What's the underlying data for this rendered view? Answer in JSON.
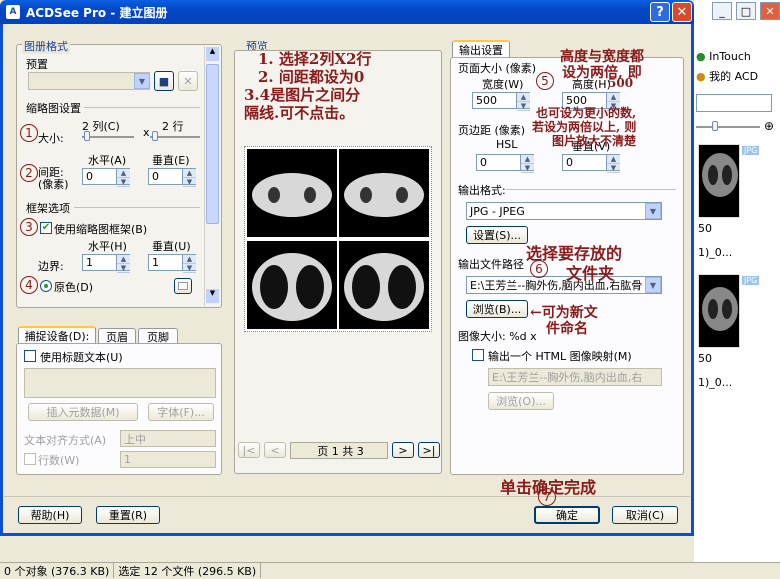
{
  "window": {
    "title": "ACDSee Pro - 建立图册",
    "help_glyph": "?",
    "close_glyph": "✕"
  },
  "left": {
    "group_title": "图册格式",
    "preset_label": "预置",
    "thumb_settings_label": "缩略图设置",
    "size_label": "大小:",
    "cols_label": "2 列(C)",
    "x_sep": "x",
    "rows_label": "2 行",
    "spacing_label": "间距:",
    "pixels_label": "(像素)",
    "horizontal_label": "水平(A)",
    "vertical_label": "垂直(E)",
    "spacing_h_value": "0",
    "spacing_v_value": "0",
    "frame_options_label": "框架选项",
    "use_frame_label": "使用缩略图框架(B)",
    "frame_h_label": "水平(H)",
    "frame_v_label": "垂直(U)",
    "border_label": "边界:",
    "border_h_value": "1",
    "border_v_value": "1",
    "original_color_label": "原色(D)"
  },
  "capture": {
    "tabs": [
      "捕捉设备(D):",
      "页眉",
      "页脚"
    ],
    "use_title_text_label": "使用标题文本(U)",
    "insert_metadata_label": "插入元数据(M)",
    "font_label": "字体(F)...",
    "text_align_label": "文本对齐方式(A)",
    "text_align_value": "上中",
    "rows_label": "行数(W)",
    "rows_value": "1"
  },
  "preview": {
    "title": "预览",
    "page_info": "页 1 共 3",
    "nav": [
      "|<",
      "<",
      ">",
      ">|"
    ]
  },
  "output": {
    "tab_label": "输出设置",
    "page_size_label": "页面大小 (像素)",
    "width_label": "宽度(W)",
    "height_label": "高度(H)",
    "width_value": "500",
    "height_value": "500",
    "margin_label": "页边距 (像素)",
    "hsl_label": "HSL",
    "vertical_label": "垂直(V)",
    "margin_h_value": "0",
    "margin_v_value": "0",
    "format_label": "输出格式:",
    "format_value": "JPG - JPEG",
    "settings_button": "设置(S)...",
    "path_label": "输出文件路径",
    "path_value": "E:\\王芳兰--胸外伤,脑内出血,右肱骨",
    "browse_button": "浏览(B)...",
    "image_size_label": "图像大小: %d x",
    "html_map_label": "输出一个 HTML 图像映射(M)",
    "html_path_value": "E:\\王芳兰--胸外伤,脑内出血,右",
    "html_browse_button": "浏览(O)..."
  },
  "footer": {
    "help_button": "帮助(H)",
    "reset_button": "重置(R)",
    "ok_button": "确定",
    "cancel_button": "取消(C)"
  },
  "annotations": {
    "preview_note_1": "1. 选择2列X2行",
    "preview_note_2": "2. 间距都设为0",
    "preview_note_3": "3.4是图片之间分",
    "preview_note_4": "隔线.可不点击。",
    "size_note_1": "高度与宽度都",
    "size_note_2": "设为两倍, 即",
    "size_note_3": "500",
    "small_note_1": "也可设为更小的数,",
    "small_note_2": "若设为两倍以上, 则",
    "small_note_3": "图片放大不清楚",
    "path_note_1": "选择要存放的",
    "path_note_2": "文件夹",
    "rename_note_1": "←可为新文",
    "rename_note_2": "件命名",
    "finish_note": "单击确定完成",
    "circle_1": "1",
    "circle_2": "2",
    "circle_3": "3",
    "circle_4": "4",
    "circle_5": "5",
    "circle_6": "6",
    "circle_7": "7"
  },
  "background_app": {
    "intouch_label": "InTouch",
    "my_acd_label": "我的 ACD",
    "thumb_badge": "JPG",
    "caption_a": "50",
    "caption_b": "1)_0...",
    "caption_c": "50",
    "caption_d": "1)_0..."
  },
  "statusbar": {
    "objects": "0 个对象 (376.3 KB)",
    "selected": "选定 12 个文件 (296.5 KB)"
  },
  "colors": {
    "title_blue": "#0546c8",
    "annotation": "#8b1a1a",
    "check_green": "#21a121"
  }
}
